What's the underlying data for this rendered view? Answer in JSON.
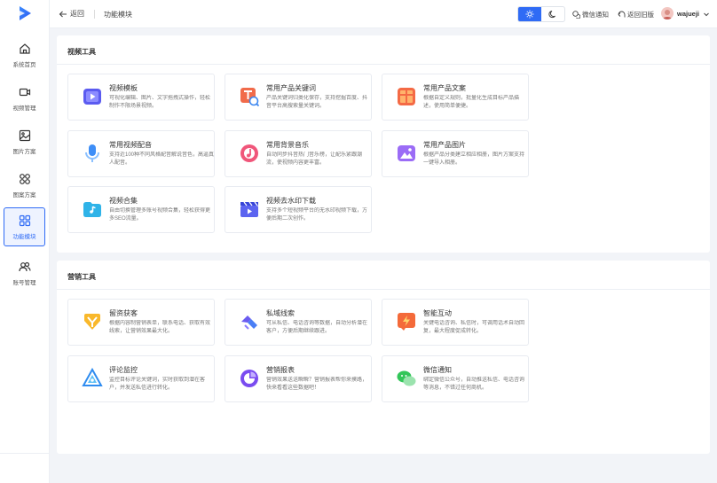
{
  "sidebar": {
    "items": [
      {
        "label": "系统首页",
        "icon": "home-icon"
      },
      {
        "label": "视频管理",
        "icon": "video-camera-icon"
      },
      {
        "label": "图片方案",
        "icon": "image-icon"
      },
      {
        "label": "图案方案",
        "icon": "pattern-grid-icon"
      },
      {
        "label": "功能模块",
        "icon": "module-grid-icon"
      },
      {
        "label": "账号管理",
        "icon": "users-icon"
      }
    ]
  },
  "header": {
    "back_label": "返回",
    "breadcrumb": "功能模块",
    "wechat_notify": "微信通知",
    "old_version": "返回旧版",
    "username": "wajueji"
  },
  "colors": {
    "accent": "#2f6bf5"
  },
  "sections": [
    {
      "title": "视频工具",
      "cards": [
        {
          "title": "视频模板",
          "desc": "可视化编辑、图片、文字拖拽式操作，轻松制作不限场景视频。",
          "icon": "video-template-icon"
        },
        {
          "title": "常用产品关键词",
          "desc": "产品关键词归类化保存，支持挖掘百度、抖音平台高搜索量关键词。",
          "icon": "keyword-search-icon"
        },
        {
          "title": "常用产品文案",
          "desc": "根据自定义规则，批量化生成目标产品描述，使用简单便捷。",
          "icon": "product-copy-icon"
        },
        {
          "title": "常用视频配音",
          "desc": "支持近100种不同风格配音解说音色，高逼真人配音。",
          "icon": "microphone-icon"
        },
        {
          "title": "常用背景音乐",
          "desc": "自动同步抖音热门音乐榜，让配乐紧跟潮流，使视频内容更丰富。",
          "icon": "music-note-icon"
        },
        {
          "title": "常用产品图片",
          "desc": "根据产品分类建立相应相册，图片方案支持一键导入相册。",
          "icon": "product-image-icon"
        },
        {
          "title": "视频合集",
          "desc": "自由切换管理多账号视频合集，轻松获得更多SEO流量。",
          "icon": "video-collection-icon"
        },
        {
          "title": "视频去水印下载",
          "desc": "支持多个短视频平台的无水印视频下载，方便后期二次创作。",
          "icon": "clapperboard-icon"
        }
      ]
    },
    {
      "title": "营销工具",
      "cards": [
        {
          "title": "留资获客",
          "desc": "根据内容制营销表单，联系电话、获取有效线索，让营销效果最大化。",
          "icon": "lead-capture-icon"
        },
        {
          "title": "私域线索",
          "desc": "可从私信、电话咨询等数据，自动分析潜在客户，方便后期继续跟进。",
          "icon": "private-leads-icon"
        },
        {
          "title": "智能互动",
          "desc": "关键电话咨询、私信时，可调用话术自动回复，最大程度促成转化。",
          "icon": "smart-interaction-icon"
        },
        {
          "title": "评论监控",
          "desc": "监控目标评论关键词，实时获取到潜在客户，并发送私信进行转化。",
          "icon": "comment-monitor-icon"
        },
        {
          "title": "营销报表",
          "desc": "营销效果送送瞬瞬？营销报表帮你来摸路，快来看看这些数据吧！",
          "icon": "marketing-report-icon"
        },
        {
          "title": "微信通知",
          "desc": "绑定微信公众号，自动推送私信、电话咨询等消息，不错过任何商机。",
          "icon": "wechat-icon"
        }
      ]
    }
  ]
}
